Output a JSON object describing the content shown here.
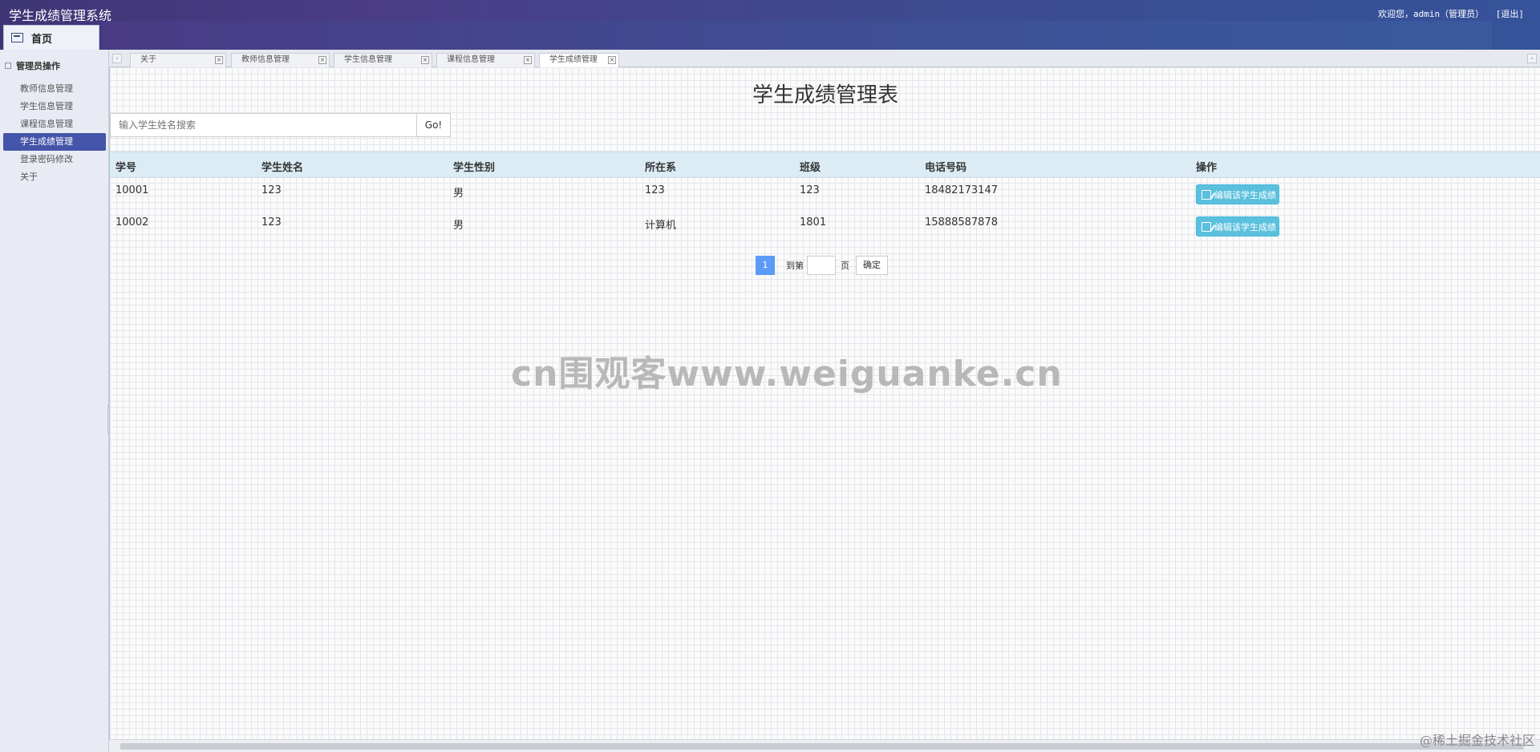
{
  "header": {
    "app_title": "学生成绩管理系统",
    "welcome": "欢迎您，admin（管理员）",
    "logout": "[退出]",
    "home_tab": "首页"
  },
  "sidebar": {
    "group_label": "管理员操作",
    "items": [
      {
        "label": "教师信息管理"
      },
      {
        "label": "学生信息管理"
      },
      {
        "label": "课程信息管理"
      },
      {
        "label": "学生成绩管理"
      },
      {
        "label": "登录密码修改"
      },
      {
        "label": "关于"
      }
    ]
  },
  "tabs": [
    {
      "label": "关于"
    },
    {
      "label": "教师信息管理"
    },
    {
      "label": "学生信息管理"
    },
    {
      "label": "课程信息管理"
    },
    {
      "label": "学生成绩管理"
    }
  ],
  "main": {
    "title": "学生成绩管理表",
    "search_placeholder": "输入学生姓名搜索",
    "go_label": "Go!",
    "columns": [
      "学号",
      "学生姓名",
      "学生性别",
      "所在系",
      "班级",
      "电话号码",
      "操作"
    ],
    "rows": [
      {
        "id": "10001",
        "name": "123",
        "gender": "男",
        "dept": "123",
        "class": "123",
        "phone": "18482173147",
        "action": "编辑该学生成绩"
      },
      {
        "id": "10002",
        "name": "123",
        "gender": "男",
        "dept": "计算机",
        "class": "1801",
        "phone": "15888587878",
        "action": "编辑该学生成绩"
      }
    ],
    "pager": {
      "current": "1",
      "goto_prefix": "到第",
      "goto_suffix": "页",
      "confirm": "确定"
    }
  },
  "watermark": "cn围观客www.weiguanke.cn",
  "corner_watermark": "@稀土掘金技术社区",
  "colors": {
    "accent": "#4454a8",
    "header": "#3e3575",
    "info_button": "#5bc0de",
    "page_active": "#5b9af7"
  }
}
